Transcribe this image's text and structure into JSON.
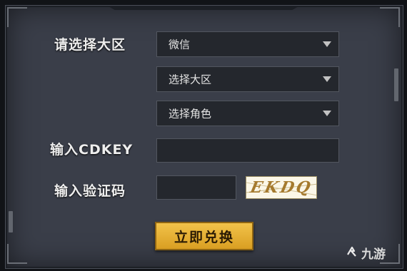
{
  "form": {
    "region_label": "请选择大区",
    "region_select_1": "微信",
    "region_select_2": "选择大区",
    "role_select": "选择角色",
    "cdkey_label": "输入CDKEY",
    "cdkey_value": "",
    "verify_label": "输入验证码",
    "verify_value": "",
    "captcha_text": "EKDQ",
    "redeem_button": "立即兑换"
  },
  "watermark": {
    "text": "九游"
  },
  "colors": {
    "panel": "#3a3e49",
    "field": "#24272d",
    "button": "#e0a92d",
    "accent_text": "#eeeeee"
  },
  "icons": {
    "dropdown": "chevron-down-icon",
    "watermark": "jiuyou-logo-icon"
  }
}
